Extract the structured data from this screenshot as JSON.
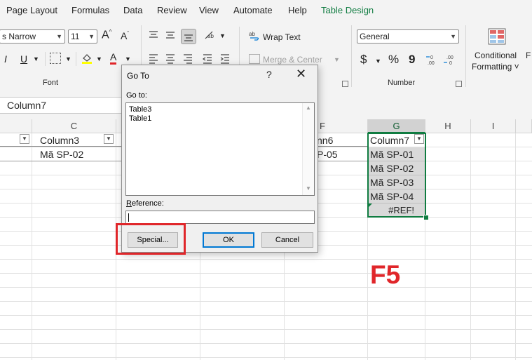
{
  "menu": {
    "items": [
      "Page Layout",
      "Formulas",
      "Data",
      "Review",
      "View",
      "Automate",
      "Help",
      "Table Design"
    ]
  },
  "ribbon": {
    "font_name": "s Narrow",
    "font_size": "11",
    "wrap_text": "Wrap Text",
    "merge_center": "Merge & Center",
    "number_format": "General",
    "currency_symbol": "$",
    "percent_symbol": "%",
    "comma_symbol": "9",
    "font_color_letter": "A",
    "underline_letter": "U",
    "italic_letter": "I",
    "cond_format_line1": "Conditional",
    "cond_format_line2": "Formatting ˅",
    "cut_off_letter": "F",
    "group_font": "Font",
    "group_number": "Number",
    "accent_color": "#107c41",
    "font_color": "#e0262a",
    "highlight_color": "#ffff00"
  },
  "namebox": {
    "value": "Column7"
  },
  "grid": {
    "columns": [
      "C",
      "F",
      "G",
      "H",
      "I"
    ],
    "header_row": {
      "col3": "Column3",
      "col6": "nn6",
      "col7": "Column7"
    },
    "row1": {
      "col3": "Mã SP-02",
      "col6": "P-05"
    },
    "col7_values": [
      "Mã SP-01",
      "Mã SP-02",
      "Mã SP-03",
      "Mã SP-04",
      "#REF!"
    ]
  },
  "dialog": {
    "title": "Go To",
    "help": "?",
    "close": "✕",
    "goto_label": "Go to:",
    "list": [
      "Table3",
      "Table1"
    ],
    "reference_label": "Reference:",
    "reference_value": "",
    "special_button": "Special...",
    "ok_button": "OK",
    "cancel_button": "Cancel"
  },
  "annotation": {
    "key_label": "F5",
    "color": "#e0262a"
  }
}
